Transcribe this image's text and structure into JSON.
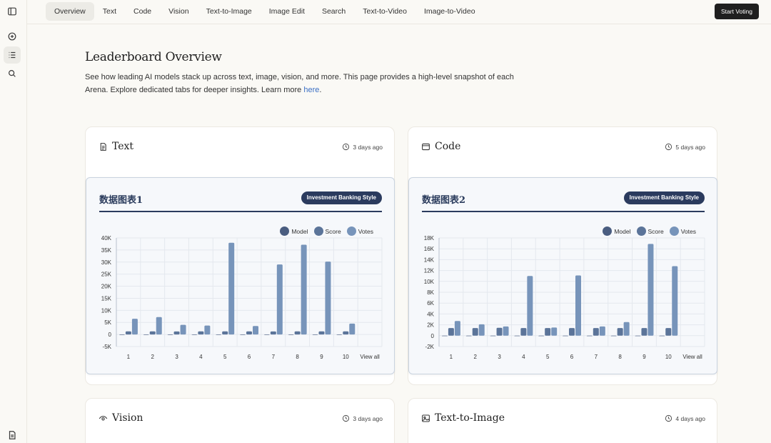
{
  "nav": {
    "tabs": [
      "Overview",
      "Text",
      "Code",
      "Vision",
      "Text-to-Image",
      "Image Edit",
      "Search",
      "Text-to-Video",
      "Image-to-Video"
    ],
    "active_tab": "Overview",
    "start_voting_label": "Start Voting"
  },
  "sidebar": {
    "icons": [
      "sidebar-toggle-icon",
      "new-chat-icon",
      "leaderboard-icon",
      "search-icon",
      "document-icon"
    ]
  },
  "page": {
    "title": "Leaderboard Overview",
    "description": "See how leading AI models stack up across text, image, vision, and more. This page provides a high-level snapshot of each Arena. Explore dedicated tabs for deeper insights. Learn more ",
    "link_text": "here",
    "link_suffix": "."
  },
  "cards": [
    {
      "title": "Text",
      "icon": "document-icon",
      "updated": "3 days ago",
      "panel": {
        "title": "数据图表1",
        "badge": "Investment Banking Style"
      }
    },
    {
      "title": "Code",
      "icon": "window-icon",
      "updated": "5 days ago",
      "panel": {
        "title": "数据图表2",
        "badge": "Investment Banking Style"
      }
    },
    {
      "title": "Vision",
      "icon": "eye-icon",
      "updated": "3 days ago"
    },
    {
      "title": "Text-to-Image",
      "icon": "image-icon",
      "updated": "4 days ago"
    }
  ],
  "colors": {
    "model": "#4a5d80",
    "score": "#5b7499",
    "votes": "#7794ba",
    "accent": "#2b3b5e",
    "link": "#3b6fc4"
  },
  "chart_data": [
    {
      "type": "bar",
      "categories": [
        "1",
        "2",
        "3",
        "4",
        "5",
        "6",
        "7",
        "8",
        "9",
        "10",
        "View all"
      ],
      "series": [
        {
          "name": "Model",
          "values": [
            0,
            0,
            0,
            0,
            0,
            0,
            0,
            0,
            0,
            0
          ]
        },
        {
          "name": "Score",
          "values": [
            1300,
            1300,
            1250,
            1300,
            1300,
            1300,
            1250,
            1300,
            1300,
            1300
          ]
        },
        {
          "name": "Votes",
          "values": [
            6500,
            7200,
            4000,
            3700,
            38000,
            3500,
            29000,
            37200,
            30200,
            4500
          ]
        }
      ],
      "ylim": [
        -5000,
        40000
      ],
      "yticks": [
        "-5K",
        "0",
        "5K",
        "10K",
        "15K",
        "20K",
        "25K",
        "30K",
        "35K",
        "40K"
      ],
      "grid": true,
      "legend": "top-right"
    },
    {
      "type": "bar",
      "categories": [
        "1",
        "2",
        "3",
        "4",
        "5",
        "6",
        "7",
        "8",
        "9",
        "10",
        "View all"
      ],
      "series": [
        {
          "name": "Model",
          "values": [
            0,
            0,
            0,
            0,
            0,
            0,
            0,
            0,
            0,
            0
          ]
        },
        {
          "name": "Score",
          "values": [
            1400,
            1400,
            1450,
            1400,
            1400,
            1400,
            1400,
            1400,
            1400,
            1400
          ]
        },
        {
          "name": "Votes",
          "values": [
            2700,
            2100,
            1700,
            11000,
            1500,
            11100,
            1700,
            2500,
            16900,
            12800
          ]
        }
      ],
      "ylim": [
        -2000,
        18000
      ],
      "yticks": [
        "-2K",
        "0",
        "2K",
        "4K",
        "6K",
        "8K",
        "10K",
        "12K",
        "14K",
        "16K",
        "18K"
      ],
      "grid": true,
      "legend": "top-right"
    }
  ]
}
